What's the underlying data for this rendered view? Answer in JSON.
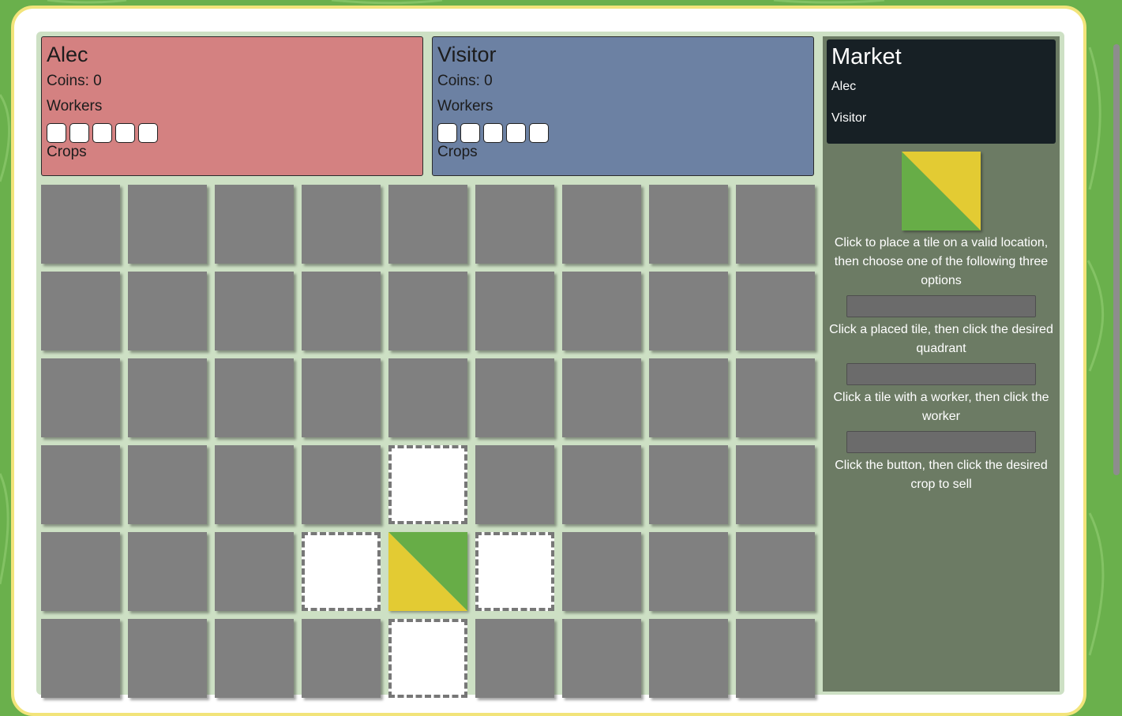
{
  "players": [
    {
      "name": "Alec",
      "coins_text": "Coins: 0",
      "workers_label": "Workers",
      "crops_label": "Crops",
      "color": "#d48181",
      "worker_slots": 5
    },
    {
      "name": "Visitor",
      "coins_text": "Coins: 0",
      "workers_label": "Workers",
      "crops_label": "Crops",
      "color": "#6c81a3",
      "worker_slots": 5
    }
  ],
  "market": {
    "title": "Market",
    "rows": [
      "Alec",
      "Visitor"
    ]
  },
  "sidebar": {
    "next_tile": {
      "colors": [
        "#67ad47",
        "#e3cb33"
      ]
    },
    "instructions": {
      "place": "Click to place a tile on a valid location, then choose one of the following three options",
      "quadrant": "Click a placed tile, then click the desired quadrant",
      "worker": "Click a tile with a worker, then click the worker",
      "sell": "Click the button, then click the desired crop to sell"
    },
    "buttons": [
      "",
      "",
      ""
    ]
  },
  "board": {
    "columns": 9,
    "rows_visible": 6,
    "valid_cells": [
      [
        3,
        4
      ],
      [
        4,
        3
      ],
      [
        4,
        5
      ],
      [
        5,
        4
      ]
    ],
    "placed_tiles": [
      {
        "row": 4,
        "col": 4,
        "colors": [
          "#67ad47",
          "#e3cb33"
        ]
      }
    ]
  },
  "colors": {
    "cell_empty": "#808080",
    "board_bg": "#cde0c4",
    "sidebar_bg": "#6c7b64",
    "market_bg": "#172025",
    "page_bg": "#6ab04c",
    "frame_border": "#f2e47a"
  }
}
